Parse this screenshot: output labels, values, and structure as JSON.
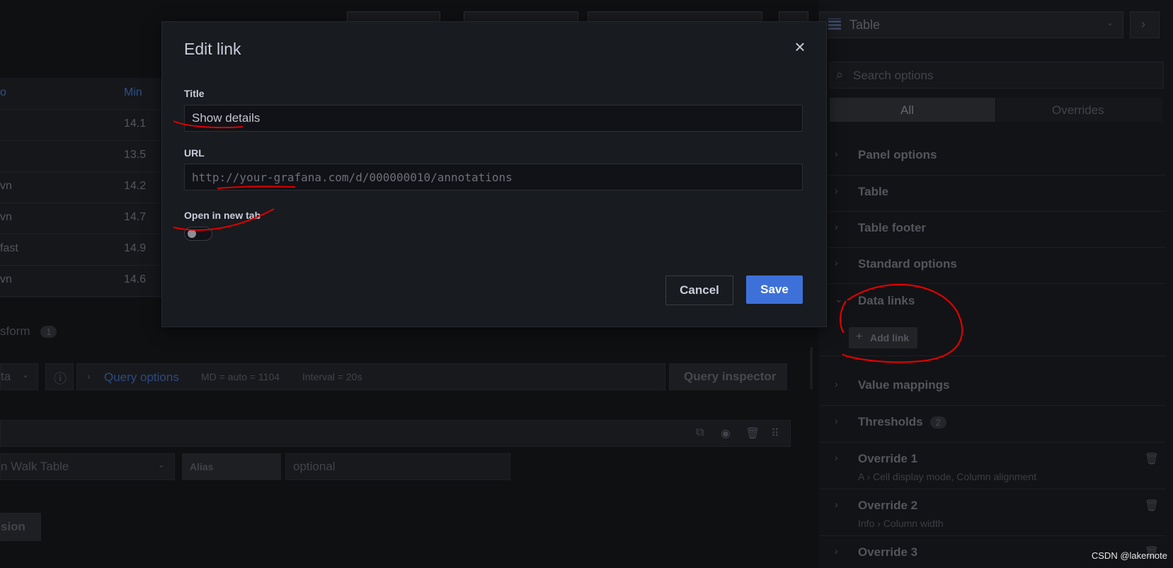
{
  "header": {
    "visualization_label": "Table"
  },
  "table": {
    "header_cells": [
      "o",
      "Min"
    ],
    "rows": [
      {
        "name": "",
        "min": "14.1"
      },
      {
        "name": "",
        "min": "13.5"
      },
      {
        "name": "vn",
        "min": "14.2"
      },
      {
        "name": "vn",
        "min": "14.7"
      },
      {
        "name": "fast",
        "min": "14.9"
      },
      {
        "name": "vn",
        "min": "14.6"
      }
    ]
  },
  "query_area": {
    "transform_label": "sform",
    "transform_count": "1",
    "datasource_partial": "ta",
    "query_options_label": "Query options",
    "md_text": "MD = auto = 1104",
    "interval_text": "Interval = 20s",
    "query_inspector_label": "Query inspector",
    "scenario_partial": "n Walk Table",
    "alias_label": "Alias",
    "alias_placeholder": "optional",
    "expression_partial": "sion"
  },
  "sidebar": {
    "search_placeholder": "Search options",
    "tab_all": "All",
    "tab_overrides": "Overrides",
    "sections": [
      {
        "title": "Panel options"
      },
      {
        "title": "Table"
      },
      {
        "title": "Table footer"
      },
      {
        "title": "Standard options"
      }
    ],
    "data_links_title": "Data links",
    "add_link_label": "Add link",
    "value_mappings_title": "Value mappings",
    "thresholds_title": "Thresholds",
    "thresholds_count": "2",
    "overrides": [
      {
        "title": "Override 1",
        "field": "A",
        "props": "Cell display mode, Column alignment"
      },
      {
        "title": "Override 2",
        "field": "Info",
        "props": "Column width"
      },
      {
        "title": "Override 3"
      }
    ]
  },
  "modal": {
    "title": "Edit link",
    "title_label": "Title",
    "title_value": "Show details",
    "url_label": "URL",
    "url_value": "http://your-grafana.com/d/000000010/annotations",
    "new_tab_label": "Open in new tab",
    "new_tab_enabled": false,
    "cancel_label": "Cancel",
    "save_label": "Save",
    "close_icon": "×"
  },
  "colors": {
    "primary_button": "#3d71d9",
    "annotation_red": "#e00000",
    "modal_bg": "#181b1f"
  },
  "watermark": "CSDN @lakernote"
}
